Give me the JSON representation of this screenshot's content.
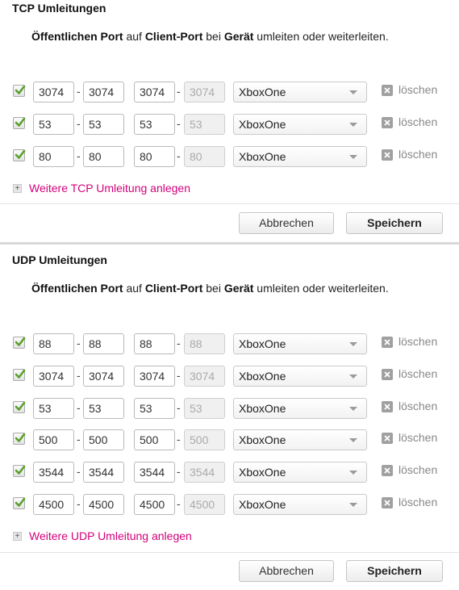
{
  "tcp": {
    "title": "TCP Umleitungen",
    "desc": {
      "part1": "Öffentlichen Port",
      "part2": " auf ",
      "part3": "Client-Port",
      "part4": " bei ",
      "part5": "Gerät",
      "part6": " umleiten oder weiterleiten."
    },
    "rows": [
      {
        "checked": true,
        "pub_from": "3074",
        "pub_to": "3074",
        "cli_from": "3074",
        "cli_to": "3074",
        "device": "XboxOne",
        "delete_label": "löschen"
      },
      {
        "checked": true,
        "pub_from": "53",
        "pub_to": "53",
        "cli_from": "53",
        "cli_to": "53",
        "device": "XboxOne",
        "delete_label": "löschen"
      },
      {
        "checked": true,
        "pub_from": "80",
        "pub_to": "80",
        "cli_from": "80",
        "cli_to": "80",
        "device": "XboxOne",
        "delete_label": "löschen"
      }
    ],
    "add_label": "Weitere TCP Umleitung anlegen",
    "cancel_label": "Abbrechen",
    "save_label": "Speichern"
  },
  "udp": {
    "title": "UDP Umleitungen",
    "desc": {
      "part1": "Öffentlichen Port",
      "part2": " auf ",
      "part3": "Client-Port",
      "part4": " bei ",
      "part5": "Gerät",
      "part6": " umleiten oder weiterleiten."
    },
    "rows": [
      {
        "checked": true,
        "pub_from": "88",
        "pub_to": "88",
        "cli_from": "88",
        "cli_to": "88",
        "device": "XboxOne",
        "delete_label": "löschen"
      },
      {
        "checked": true,
        "pub_from": "3074",
        "pub_to": "3074",
        "cli_from": "3074",
        "cli_to": "3074",
        "device": "XboxOne",
        "delete_label": "löschen"
      },
      {
        "checked": true,
        "pub_from": "53",
        "pub_to": "53",
        "cli_from": "53",
        "cli_to": "53",
        "device": "XboxOne",
        "delete_label": "löschen"
      },
      {
        "checked": true,
        "pub_from": "500",
        "pub_to": "500",
        "cli_from": "500",
        "cli_to": "500",
        "device": "XboxOne",
        "delete_label": "löschen"
      },
      {
        "checked": true,
        "pub_from": "3544",
        "pub_to": "3544",
        "cli_from": "3544",
        "cli_to": "3544",
        "device": "XboxOne",
        "delete_label": "löschen"
      },
      {
        "checked": true,
        "pub_from": "4500",
        "pub_to": "4500",
        "cli_from": "4500",
        "cli_to": "4500",
        "device": "XboxOne",
        "delete_label": "löschen"
      }
    ],
    "add_label": "Weitere UDP Umleitung anlegen",
    "cancel_label": "Abbrechen",
    "save_label": "Speichern"
  },
  "colors": {
    "accent": "#d3007a",
    "checkmark": "#5aa02c"
  },
  "icons": {
    "checkbox": "checkmark-icon",
    "delete": "close-x-icon",
    "add": "plus-icon",
    "select": "chevron-down-icon"
  }
}
